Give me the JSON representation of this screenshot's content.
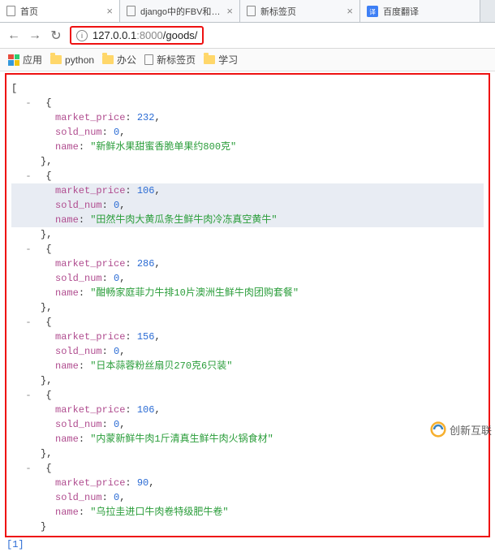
{
  "tabs": [
    {
      "title": "首页",
      "icon": "page"
    },
    {
      "title": "django中的FBV和CBV",
      "icon": "page"
    },
    {
      "title": "新标签页",
      "icon": "page"
    },
    {
      "title": "百度翻译",
      "icon": "translate"
    }
  ],
  "addr": {
    "url_host": "127.0.0.1",
    "url_port": ":8000",
    "url_path": "/goods/"
  },
  "bookmarks": {
    "apps": "应用",
    "items": [
      {
        "label": "python"
      },
      {
        "label": "办公"
      },
      {
        "label": "新标签页",
        "icon": "page"
      },
      {
        "label": "学习"
      }
    ]
  },
  "json_items": [
    {
      "market_price": 232,
      "sold_num": 0,
      "name": "新鲜水果甜蜜香脆单果约800克",
      "highlight": false
    },
    {
      "market_price": 106,
      "sold_num": 0,
      "name": "田然牛肉大黄瓜条生鲜牛肉冷冻真空黄牛",
      "highlight": true
    },
    {
      "market_price": 286,
      "sold_num": 0,
      "name": "酣畅家庭菲力牛排10片澳洲生鲜牛肉团购套餐",
      "highlight": false
    },
    {
      "market_price": 156,
      "sold_num": 0,
      "name": "日本蒜蓉粉丝扇贝270克6只装",
      "highlight": false
    },
    {
      "market_price": 106,
      "sold_num": 0,
      "name": "内蒙新鲜牛肉1斤清真生鲜牛肉火锅食材",
      "highlight": false
    },
    {
      "market_price": 90,
      "sold_num": 0,
      "name": "乌拉圭进口牛肉卷特级肥牛卷",
      "highlight": false
    }
  ],
  "keys": {
    "market_price": "market_price",
    "sold_num": "sold_num",
    "name": "name"
  },
  "footer": "[1]",
  "watermark": "创新互联"
}
